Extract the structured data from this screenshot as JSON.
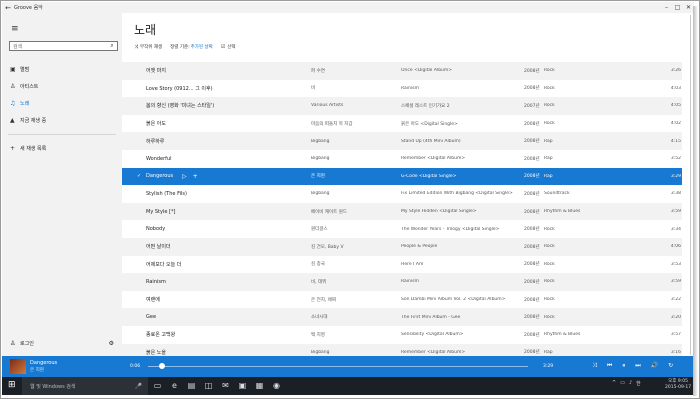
{
  "window": {
    "title": "Groove 음악",
    "back_glyph": "←",
    "min_glyph": "–",
    "max_glyph": "□",
    "close_glyph": "✕"
  },
  "sidebar": {
    "menu_glyph": "≡",
    "search_placeholder": "검색",
    "search_glyph": "⌕",
    "items": [
      {
        "label": "앨범",
        "icon_glyph": "▣"
      },
      {
        "label": "아티스트",
        "icon_glyph": "♙"
      },
      {
        "label": "노래",
        "icon_glyph": "♫"
      },
      {
        "label": "지금 재생 중",
        "icon_glyph": "▲"
      }
    ],
    "new_playlist": {
      "label": "새 재생 목록",
      "icon_glyph": "+"
    },
    "login": {
      "label": "로그인",
      "icon_glyph": "♙",
      "settings_glyph": "⚙"
    }
  },
  "main": {
    "heading": "노래",
    "toolbar": [
      {
        "icon_glyph": "⤨",
        "label": "무작위 재생",
        "value": ""
      },
      {
        "icon_glyph": "",
        "label": "정렬 기준:",
        "value": "추가된 날짜"
      },
      {
        "icon_glyph": "☑",
        "label": "선택",
        "value": ""
      }
    ],
    "songs": [
      {
        "title": "어젯 마지",
        "artist": "퍼 수연",
        "album": "Once <Digital Album>",
        "year": "2008년",
        "genre": "Rock",
        "duration": "3:26"
      },
      {
        "title": "Love Story (0912... 그 이후)",
        "artist": "비",
        "album": "Rainism",
        "year": "2008년",
        "genre": "Rock",
        "duration": "4:03"
      },
      {
        "title": "봄의 향신 (영화 '미녀는 스타일')",
        "artist": "Various Artists",
        "album": "스페셜 레스트 인기가요 2",
        "year": "2007년",
        "genre": "Rock",
        "duration": "4:05"
      },
      {
        "title": "붉은 아도",
        "artist": "마음의 떠돌지 목 지갑",
        "album": "붉은 아도 <Digital Single>",
        "year": "2008년",
        "genre": "Rock",
        "duration": "4:02"
      },
      {
        "title": "하루하루",
        "artist": "Bigbang",
        "album": "Stand Up (4th Mini Album)",
        "year": "2008년",
        "genre": "Rap",
        "duration": "4:15"
      },
      {
        "title": "Wonderful",
        "artist": "Bigbang",
        "album": "Remember <Digital Album>",
        "year": "2008년",
        "genre": "Rap",
        "duration": "3:52"
      },
      {
        "title": "Dangerous",
        "artist": "은 지현",
        "album": "G-Code <Digital Single>",
        "year": "2008년",
        "genre": "Rap",
        "duration": "3:29"
      },
      {
        "title": "Stylish (The Fils)",
        "artist": "Bigbang",
        "album": "Fix Limited Edition With Bigbang <Digital Single>",
        "year": "2008년",
        "genre": "Soundtrack",
        "duration": "3:38"
      },
      {
        "title": "My Style [*]",
        "artist": "베이비 캐이트 원드",
        "album": "My Style Hidden <Digital Single>",
        "year": "2008년",
        "genre": "Rhythm & Blues",
        "duration": "3:59"
      },
      {
        "title": "Nobody",
        "artist": "원더걸스",
        "album": "The Wonder Years - Trilogy <Digital Single>",
        "year": "2008년",
        "genre": "Rock",
        "duration": "3:34"
      },
      {
        "title": "어떤 날이더",
        "artist": "김 건모, Baby V",
        "album": "People & People",
        "year": "2008년",
        "genre": "Rock",
        "duration": "4:06"
      },
      {
        "title": "어제보다 오늘 더",
        "artist": "김 종국",
        "album": "Here I Am",
        "year": "2008년",
        "genre": "Rock",
        "duration": "3:53"
      },
      {
        "title": "Rainism",
        "artist": "비, 데뷔",
        "album": "Rainism",
        "year": "2008년",
        "genre": "Rock",
        "duration": "3:59"
      },
      {
        "title": "여랜에",
        "artist": "은 전지, 에찌",
        "album": "Son Dambi Mini Album Vol. 2 <Digital Album>",
        "year": "2008년",
        "genre": "Rock",
        "duration": "3:22"
      },
      {
        "title": "Gee",
        "artist": "소녀시대",
        "album": "The First Mini Album - Gee",
        "year": "2008년",
        "genre": "Rock",
        "duration": "3:20"
      },
      {
        "title": "종료온 고백왕",
        "artist": "백 지영",
        "album": "Sensibility <Digital Album>",
        "year": "2008년",
        "genre": "Rhythm & Blues",
        "duration": "3:57"
      },
      {
        "title": "붉은 노을",
        "artist": "Bigbang",
        "album": "Remember <Digital Album>",
        "year": "2008년",
        "genre": "Rap",
        "duration": "3:16"
      }
    ],
    "selected_index": 6
  },
  "player": {
    "title": "Dangerous",
    "artist": "은 지현",
    "elapsed": "0:06",
    "total": "3:29",
    "progress": 0.03,
    "controls": [
      "⤨",
      "⏮",
      "⏸",
      "⏭",
      "🔊",
      "↻"
    ]
  },
  "taskbar": {
    "start_glyph": "⊞",
    "search_text": "웹 및 Windows 검색",
    "mic_glyph": "🎤",
    "apps": [
      "▭",
      "e",
      "▤",
      "◫",
      "✉",
      "▣",
      "▦",
      "◉"
    ],
    "tray": [
      "^",
      "▭",
      "♪",
      "한"
    ],
    "time": "오후 9:05",
    "date": "2015-09-17"
  },
  "colors": {
    "accent": "#1879d2",
    "sidebar_bg": "#f2f2f2",
    "taskbar_bg": "#1b1f26"
  }
}
